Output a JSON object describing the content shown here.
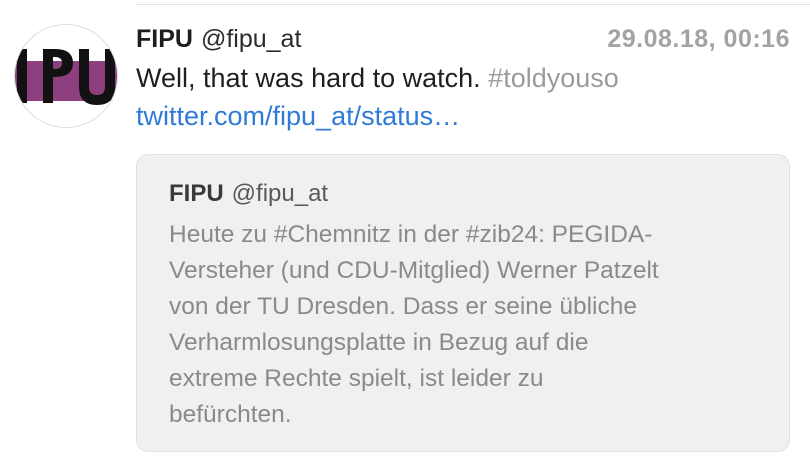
{
  "tweet": {
    "author_name": "FIPU",
    "author_handle": "@fipu_at",
    "timestamp": "29.08.18, 00:16",
    "text": "Well, that was hard to watch.",
    "hashtag": "#toldyouso",
    "link": "twitter.com/fipu_at/status…",
    "avatar_icon": "fipu-logo-avatar"
  },
  "quoted_tweet": {
    "author_name": "FIPU",
    "author_handle": "@fipu_at",
    "lines": [
      "Heute zu #Chemnitz in der #zib24: PEGIDA-",
      "Versteher (und CDU-Mitglied) Werner Patzelt",
      "von der TU Dresden. Dass er seine übliche",
      "Verharmlosungsplatte in Bezug auf die",
      "extreme Rechte spielt, ist leider zu",
      "befürchten."
    ]
  },
  "colors": {
    "link": "#2f7bd6",
    "hashtag": "#9b9b9b",
    "timestamp": "#a3a3a3",
    "quote_background": "#f0f0f0",
    "avatar_purple": "#8e3f7d"
  }
}
